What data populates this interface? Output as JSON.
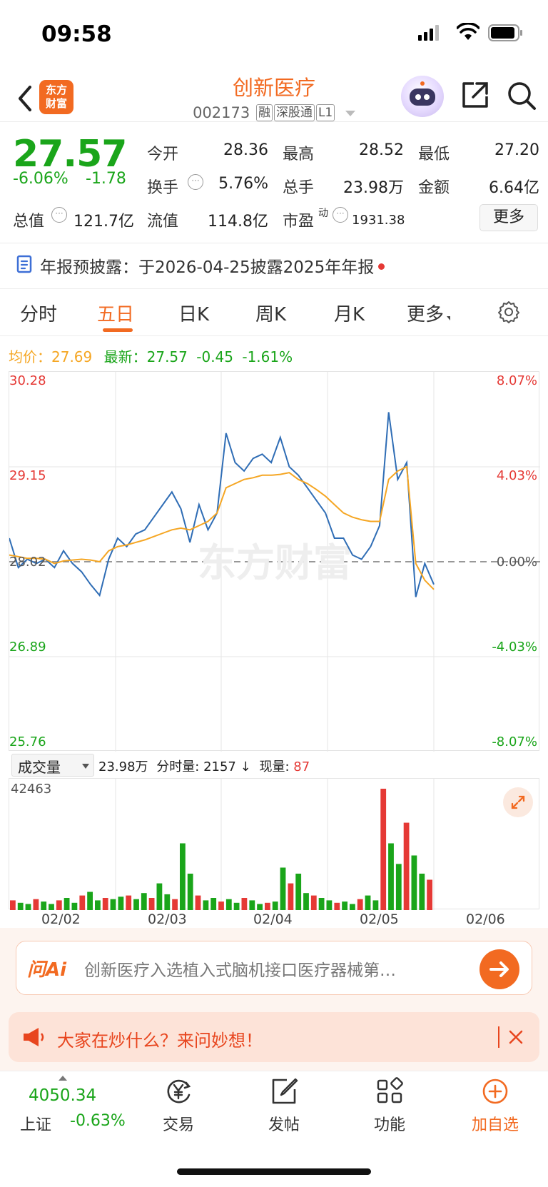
{
  "status_bar": {
    "time": "09:58"
  },
  "header": {
    "logo_text_line1": "东方",
    "logo_text_line2": "财富",
    "title": "创新医疗",
    "code": "002173",
    "tags": [
      "融",
      "深股通",
      "L1"
    ]
  },
  "quote": {
    "price": "27.57",
    "change_pct": "-6.06%",
    "change": "-1.78",
    "open_label": "今开",
    "open": "28.36",
    "high_label": "最高",
    "high": "28.52",
    "low_label": "最低",
    "low": "27.20",
    "turnover_label": "换手",
    "turnover": "5.76%",
    "volume_label": "总手",
    "volume": "23.98万",
    "amount_label": "金额",
    "amount": "6.64亿",
    "mktcap_label": "总值",
    "mktcap": "121.7亿",
    "float_label": "流值",
    "float_cap": "114.8亿",
    "pe_label": "市盈",
    "pe_sup": "动",
    "pe": "1931.38",
    "more_label": "更多"
  },
  "notice": {
    "text": "年报预披露：于2026-04-25披露2025年年报"
  },
  "tabs": [
    {
      "label": "分时"
    },
    {
      "label": "五日"
    },
    {
      "label": "日K"
    },
    {
      "label": "周K"
    },
    {
      "label": "月K"
    },
    {
      "label": "更多"
    }
  ],
  "chart_legend": {
    "avg_label": "均价：",
    "avg": "27.69",
    "latest_label": "最新：",
    "latest": "27.57",
    "latest_chg": "-0.45",
    "latest_pct": "-1.61%"
  },
  "chart_data": {
    "type": "line",
    "y_left_ticks": [
      "30.28",
      "29.15",
      "28.02",
      "26.89",
      "25.76"
    ],
    "y_right_ticks": [
      "8.07%",
      "4.03%",
      "0.00%",
      "-4.03%",
      "-8.07%"
    ],
    "ylim": [
      25.76,
      30.28
    ],
    "prev_close": 28.02,
    "days": [
      "02/02",
      "02/03",
      "02/04",
      "02/05",
      "02/06"
    ],
    "series": [
      {
        "values": [
          28.3,
          27.95,
          28.05,
          28.0,
          28.05,
          27.95,
          28.15,
          28.0,
          27.9,
          27.75,
          27.62,
          28.05,
          28.3,
          28.2,
          28.35,
          28.4,
          28.55,
          28.7,
          28.85,
          28.65,
          28.25,
          28.7,
          28.4,
          28.6,
          29.55,
          29.2,
          29.1,
          29.25,
          29.3,
          29.2,
          29.5,
          29.15,
          29.05,
          28.9,
          28.75,
          28.6,
          28.3,
          28.3,
          28.1,
          28.05,
          28.2,
          28.45,
          29.8,
          29.0,
          29.2,
          27.6,
          28.0,
          27.75
        ]
      },
      {
        "values": [
          28.1,
          28.08,
          28.06,
          28.06,
          28.05,
          28.0,
          28.03,
          28.04,
          28.05,
          28.04,
          28.02,
          28.15,
          28.2,
          28.22,
          28.25,
          28.28,
          28.32,
          28.36,
          28.4,
          28.42,
          28.4,
          28.45,
          28.5,
          28.6,
          28.9,
          28.95,
          29.0,
          29.02,
          29.05,
          29.05,
          29.06,
          29.08,
          29.0,
          28.95,
          28.88,
          28.8,
          28.7,
          28.6,
          28.55,
          28.52,
          28.5,
          28.5,
          29.0,
          29.1,
          29.15,
          28.0,
          27.8,
          27.69
        ]
      }
    ]
  },
  "volume": {
    "selector_label": "成交量",
    "total": "23.98万",
    "minute_label": "分时量:",
    "minute_val": "2157",
    "current_label": "现量:",
    "current_val": "87",
    "max_tick": "42463",
    "values": [
      0.08,
      0.06,
      0.05,
      0.09,
      0.07,
      0.05,
      0.08,
      0.1,
      0.06,
      0.12,
      0.15,
      0.08,
      0.1,
      0.09,
      0.11,
      0.12,
      0.09,
      0.14,
      0.1,
      0.22,
      0.13,
      0.09,
      0.55,
      0.3,
      0.12,
      0.08,
      0.1,
      0.07,
      0.09,
      0.06,
      0.1,
      0.08,
      0.05,
      0.06,
      0.07,
      0.35,
      0.22,
      0.3,
      0.14,
      0.12,
      0.1,
      0.08,
      0.06,
      0.07,
      0.05,
      0.09,
      0.12,
      0.08,
      1.0,
      0.55,
      0.38,
      0.72,
      0.45,
      0.3,
      0.25
    ]
  },
  "ai": {
    "text": "创新医疗入选植入式脑机接口医疗器械第…"
  },
  "promo": {
    "text": "大家在炒什么？来问妙想！"
  },
  "bottom_nav": {
    "index_value": "4050.34",
    "index_name": "上证",
    "index_change": "-0.63%",
    "trade": "交易",
    "post": "发帖",
    "function": "功能",
    "add": "加自选"
  },
  "colors": {
    "up": "#e53935",
    "down": "#1aa51a",
    "brand": "#f26a21",
    "avg_line": "#f5a623",
    "price_line": "#2f6db5"
  }
}
